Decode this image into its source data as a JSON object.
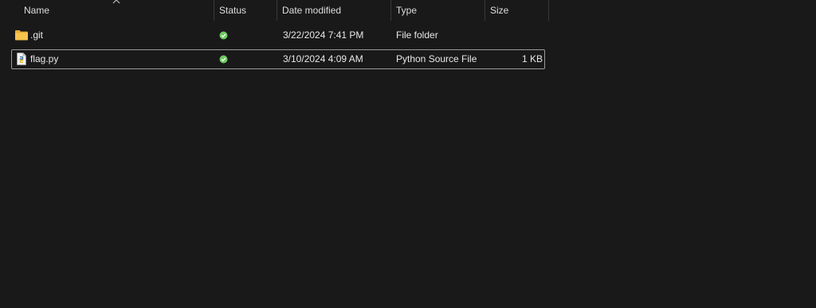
{
  "columns": {
    "name": "Name",
    "status": "Status",
    "date_modified": "Date modified",
    "type": "Type",
    "size": "Size"
  },
  "sort": {
    "column": "name",
    "direction": "ascending",
    "icon": "chevron-up-icon"
  },
  "rows": [
    {
      "name": ".git",
      "icon": "folder-icon",
      "status_icon": "sync-ok-icon",
      "date_modified": "3/22/2024 7:41 PM",
      "type": "File folder",
      "size": ""
    },
    {
      "name": "flag.py",
      "icon": "python-file-icon",
      "status_icon": "sync-ok-icon",
      "date_modified": "3/10/2024 4:09 AM",
      "type": "Python Source File",
      "size": "1 KB"
    }
  ],
  "colors": {
    "background": "#191919",
    "text": "#e8e8e8",
    "header_text": "#dedede",
    "folder": "#f2c14e",
    "status_ok": "#6ccb5f",
    "focus_border": "#9a9a9a"
  }
}
